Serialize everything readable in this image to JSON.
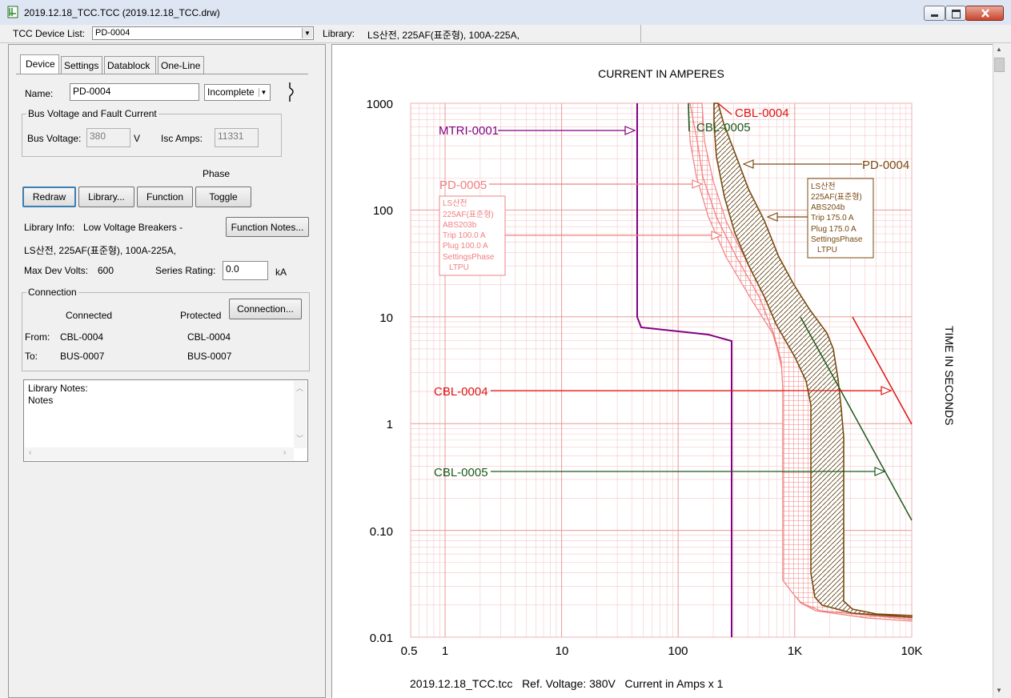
{
  "window": {
    "title": "2019.12.18_TCC.TCC (2019.12.18_TCC.drw)"
  },
  "devbar": {
    "device_list_label": "TCC Device List:",
    "device_selected": "PD-0004",
    "library_label": "Library:",
    "library_value": "LS산전, 225AF(표준형), 100A-225A,"
  },
  "tabs": [
    "Device",
    "Settings",
    "Datablock",
    "One-Line"
  ],
  "device": {
    "name_label": "Name:",
    "name_value": "PD-0004",
    "status_value": "Incomplete",
    "bus_group_title": "Bus Voltage and Fault Current",
    "bus_voltage_label": "Bus Voltage:",
    "bus_voltage_value": "380",
    "bus_voltage_unit": "V",
    "isc_label": "Isc Amps:",
    "isc_value": "11331",
    "phase_label": "Phase",
    "buttons": {
      "redraw": "Redraw",
      "library": "Library...",
      "function": "Function",
      "toggle": "Toggle",
      "function_notes": "Function Notes...",
      "connection": "Connection..."
    },
    "library_info_label": "Library Info:",
    "library_info_value": "Low Voltage Breakers -",
    "library_info_line2": "LS산전, 225AF(표준형), 100A-225A,",
    "max_dev_volts_label": "Max Dev Volts:",
    "max_dev_volts_value": "600",
    "series_rating_label": "Series Rating:",
    "series_rating_value": "0.0",
    "series_rating_unit": "kA",
    "connection_group_title": "Connection",
    "connected_header": "Connected",
    "protected_header": "Protected",
    "from_label": "From:",
    "to_label": "To:",
    "from_connected": "CBL-0004",
    "from_protected": "CBL-0004",
    "to_connected": "BUS-0007",
    "to_protected": "BUS-0007",
    "notes_line1": "Library Notes:",
    "notes_line2": "Notes"
  },
  "chart": {
    "top_label": "CURRENT IN AMPERES",
    "right_label": "TIME IN SECONDS",
    "footer": "2019.12.18_TCC.tcc   Ref. Voltage: 380V   Current in Amps x 1",
    "y_ticks": [
      "1000",
      "100",
      "10",
      "1",
      "0.10",
      "0.01"
    ],
    "x_ticks": [
      "0.5",
      "1",
      "10",
      "100",
      "1K",
      "10K"
    ],
    "devices": {
      "mtri": "MTRI-0001",
      "pd5": "PD-0005",
      "pd4": "PD-0004",
      "cbl4": "CBL-0004",
      "cbl5": "CBL-0005",
      "cbl4_top": "CBL-0004",
      "cbl5_top": "CBL-0005"
    },
    "pd5_box": [
      "LS산전",
      "225AF(표준형)",
      "ABS203b",
      "Trip 100.0 A",
      "Plug 100.0 A",
      "SettingsPhase",
      "LTPU"
    ],
    "pd4_box": [
      "LS산전",
      "225AF(표준형)",
      "ABS204b",
      "Trip 175.0 A",
      "Plug 175.0 A",
      "SettingsPhase",
      "LTPU"
    ],
    "colors": {
      "mtri": "#800080",
      "pd5": "#f08080",
      "pd4": "#7a4a10",
      "cbl4": "#e01010",
      "cbl5": "#1a5a1a",
      "grid": "#f4c8c8"
    }
  }
}
